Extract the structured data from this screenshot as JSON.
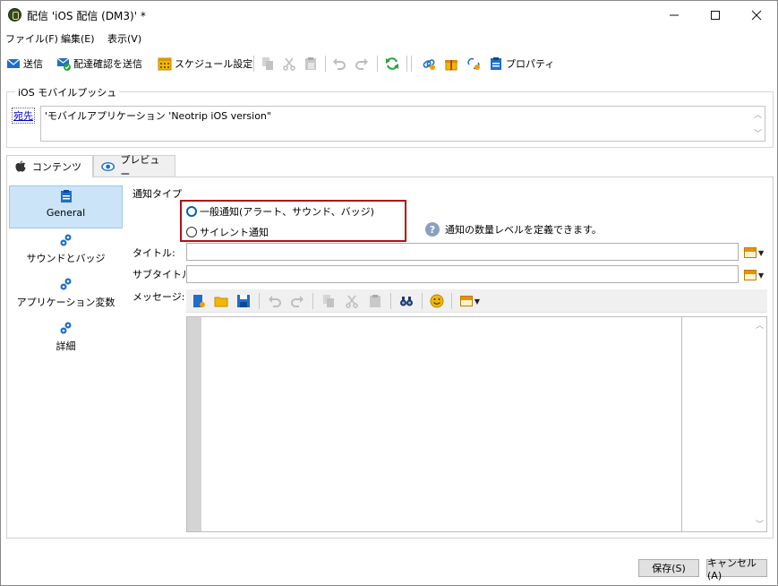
{
  "window": {
    "title": "配信 'iOS 配信 (DM3)' *",
    "minimize": "—",
    "maximize": "☐",
    "close": "✕"
  },
  "menu": [
    "ファイル(F)",
    "編集(E)",
    "表示(V)"
  ],
  "toolbar": {
    "send": "送信",
    "send_proof": "配達確認を送信",
    "schedule": "スケジュール設定",
    "properties": "プロパティ"
  },
  "recipient_group": {
    "legend": "iOS モバイルプッシュ",
    "to_link": "宛先",
    "to_value": "'モバイルアプリケーション 'Neotrip iOS version\""
  },
  "tabs": [
    {
      "label": "コンテンツ",
      "icon": "apple-icon",
      "active": true
    },
    {
      "label": "プレビュー",
      "icon": "eye-icon",
      "active": false
    }
  ],
  "nav": [
    {
      "label": "General",
      "icon": "clipboard-icon",
      "selected": true
    },
    {
      "label": "サウンドとバッジ",
      "icon": "gears-icon",
      "selected": false
    },
    {
      "label": "アプリケーション変数",
      "icon": "gears-icon",
      "selected": false
    },
    {
      "label": "詳細",
      "icon": "gears-icon",
      "selected": false
    }
  ],
  "form": {
    "notification_type_label": "通知タイプ",
    "radio_standard": "一般通知(アラート、サウンド、バッジ)",
    "radio_silent": "サイレント通知",
    "selected": "standard",
    "help_text": "通知の数量レベルを定義できます。",
    "title_label": "タイトル:",
    "title_value": "",
    "subtitle_label": "サブタイトル:",
    "subtitle_value": "",
    "message_label": "メッセージ:",
    "message_value": ""
  },
  "buttons": {
    "save": "保存(S)",
    "cancel": "キャンセル(A)"
  },
  "colors": {
    "highlight_border": "#b40d16",
    "nav_selected": "#cce4f7",
    "accent": "#0063b1"
  }
}
